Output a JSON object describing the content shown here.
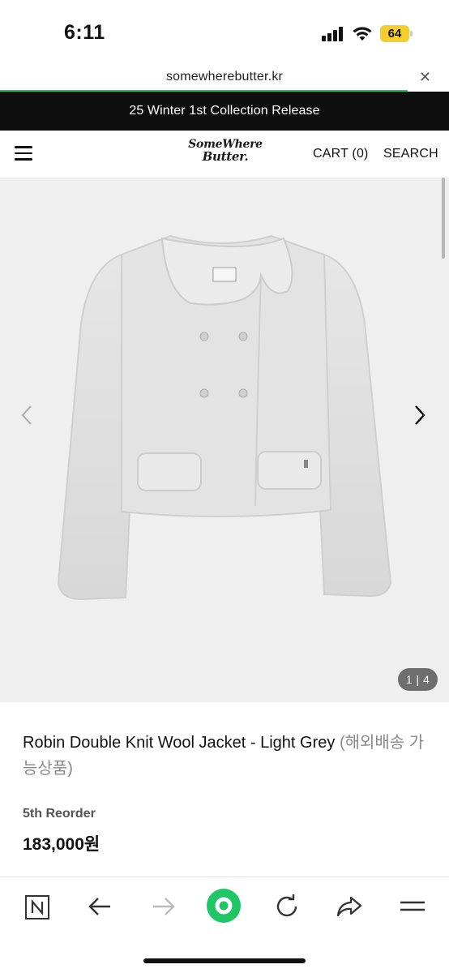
{
  "status_bar": {
    "time": "6:11",
    "battery_level": "64",
    "battery_color": "#f5cd2e"
  },
  "browser": {
    "url": "somewherebutter.kr",
    "close_icon": "close-icon",
    "progress_color": "#1ec763"
  },
  "announcement": {
    "text": "25 Winter 1st Collection Release"
  },
  "header": {
    "menu_icon": "hamburger-menu-icon",
    "logo_line1": "SomeWhere",
    "logo_line2": "Butter.",
    "cart_label": "CART (0)",
    "search_label": "SEARCH"
  },
  "gallery": {
    "image": "grey-knit-jacket-photo",
    "prev_icon": "chevron-left-icon",
    "next_icon": "chevron-right-icon",
    "counter": "1 | 4"
  },
  "product": {
    "title": "Robin Double Knit Wool Jacket - Light Grey",
    "title_suffix": "(해외배송 가능상품)",
    "reorder_label": "5th Reorder",
    "price": "183,000원"
  },
  "toolbar": {
    "accent_color": "#1ec763",
    "buttons": [
      "naver-home-icon",
      "back-arrow-icon",
      "forward-arrow-icon",
      "green-dot-icon",
      "refresh-icon",
      "share-icon",
      "menu-icon"
    ]
  }
}
